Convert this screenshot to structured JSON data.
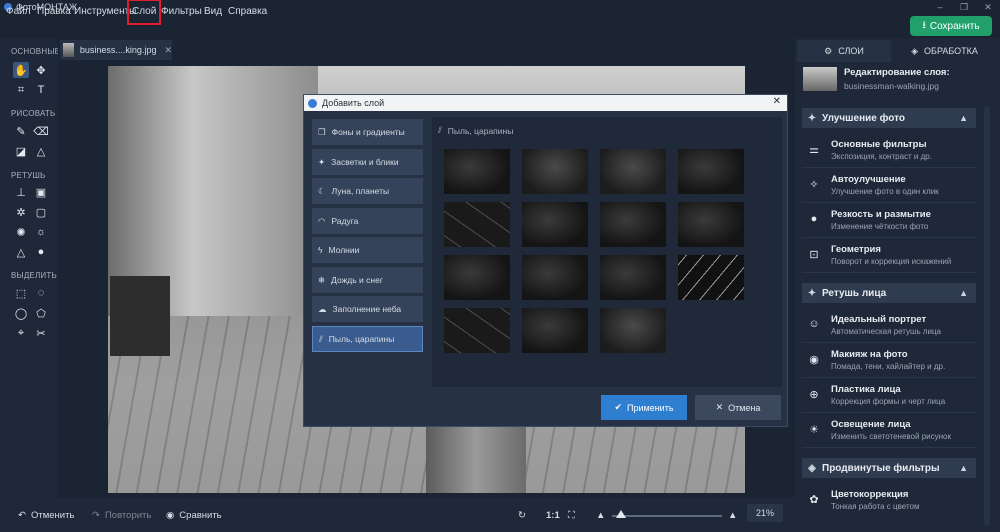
{
  "app": {
    "title": "ФотоМОНТАЖ",
    "icon": "app-logo-icon"
  },
  "window_controls": {
    "minimize": "–",
    "maximize": "❐",
    "close": "✕"
  },
  "menu": {
    "items": [
      "Файл",
      "Правка",
      "Инструменты",
      "Слой",
      "Фильтры",
      "Вид",
      "Справка"
    ],
    "highlighted": "Слой"
  },
  "save_button": {
    "label": "Сохранить",
    "icon": "download-icon",
    "color": "#22a06b"
  },
  "tools": {
    "groups": [
      "ОСНОВНЫЕ",
      "РИСОВАТЬ",
      "РЕТУШЬ",
      "ВЫДЕЛИТЬ"
    ]
  },
  "document_tab": {
    "name": "business....king.jpg"
  },
  "right_panel": {
    "tabs": [
      "СЛОИ",
      "ОБРАБОТКА"
    ],
    "layer_edit": {
      "title": "Редактирование слоя:",
      "file": "businessman-walking.jpg"
    },
    "sections": [
      {
        "title": "Улучшение фото",
        "icon": "magic-wand-icon",
        "items": [
          {
            "title": "Основные фильтры",
            "subtitle": "Экспозиция, контраст и др.",
            "icon": "sliders-icon"
          },
          {
            "title": "Автоулучшение",
            "subtitle": "Улучшение фото в один клик",
            "icon": "magic-wand-icon"
          },
          {
            "title": "Резкость и размытие",
            "subtitle": "Изменение чёткости фото",
            "icon": "drop-icon"
          },
          {
            "title": "Геометрия",
            "subtitle": "Поворот и коррекция искажений",
            "icon": "geometry-icon"
          }
        ]
      },
      {
        "title": "Ретушь лица",
        "icon": "face-wand-icon",
        "items": [
          {
            "title": "Идеальный портрет",
            "subtitle": "Автоматическая ретушь лица",
            "icon": "portrait-icon"
          },
          {
            "title": "Макияж на фото",
            "subtitle": "Помада, тени, хайлайтер и др.",
            "icon": "makeup-icon"
          },
          {
            "title": "Пластика лица",
            "subtitle": "Коррекция формы и черт лица",
            "icon": "face-shape-icon"
          },
          {
            "title": "Освещение лица",
            "subtitle": "Изменить светотеневой рисунок",
            "icon": "face-light-icon"
          }
        ]
      },
      {
        "title": "Продвинутые фильтры",
        "icon": "advanced-filter-icon",
        "items": [
          {
            "title": "Цветокоррекция",
            "subtitle": "Тонкая работа с цветом",
            "icon": "palette-icon"
          }
        ]
      }
    ]
  },
  "bottom_bar": {
    "undo": "Отменить",
    "redo": "Повторить",
    "compare": "Сравнить",
    "ratio": "1:1",
    "zoom": "21%",
    "zoom_level": 0.04
  },
  "dialog": {
    "title": "Добавить слой",
    "categories": [
      {
        "label": "Фоны и градиенты",
        "icon": "layers-icon"
      },
      {
        "label": "Засветки и блики",
        "icon": "sparkle-icon"
      },
      {
        "label": "Луна, планеты",
        "icon": "moon-icon"
      },
      {
        "label": "Радуга",
        "icon": "rainbow-icon"
      },
      {
        "label": "Молнии",
        "icon": "lightning-icon"
      },
      {
        "label": "Дождь и снег",
        "icon": "snowflake-icon"
      },
      {
        "label": "Заполнение неба",
        "icon": "cloud-icon"
      },
      {
        "label": "Пыль, царапины",
        "icon": "scratches-icon"
      }
    ],
    "selected_category": "Пыль, царапины",
    "content_header": "Пыль, царапины",
    "textures_count": 15,
    "apply_label": "Применить",
    "cancel_label": "Отмена"
  }
}
